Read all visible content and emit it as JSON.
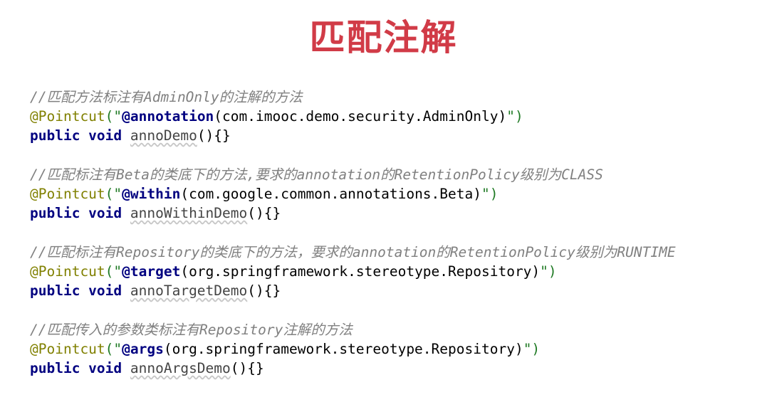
{
  "title": "匹配注解",
  "blocks": [
    {
      "comment": "//匹配方法标注有AdminOnly的注解的方法",
      "pointcut": "@Pointcut",
      "open": "(\"",
      "designator": "@annotation",
      "arg": "(com.imooc.demo.security.AdminOnly)",
      "close": "\")",
      "keywords": "public void",
      "method": "annoDemo",
      "suffix": "(){}"
    },
    {
      "comment": "//匹配标注有Beta的类底下的方法,要求的annotation的RetentionPolicy级别为CLASS",
      "pointcut": "@Pointcut",
      "open": "(\"",
      "designator": "@within",
      "arg": "(com.google.common.annotations.Beta)",
      "close": "\")",
      "keywords": "public void",
      "method": "annoWithinDemo",
      "suffix": "(){}"
    },
    {
      "comment": "//匹配标注有Repository的类底下的方法，要求的annotation的RetentionPolicy级别为RUNTIME",
      "pointcut": "@Pointcut",
      "open": "(\"",
      "designator": "@target",
      "arg": "(org.springframework.stereotype.Repository)",
      "close": "\")",
      "keywords": "public void",
      "method": "annoTargetDemo",
      "suffix": "(){}"
    },
    {
      "comment": "//匹配传入的参数类标注有Repository注解的方法",
      "pointcut": "@Pointcut",
      "open": "(\"",
      "designator": "@args",
      "arg": "(org.springframework.stereotype.Repository)",
      "close": "\")",
      "keywords": "public void",
      "method": "annoArgsDemo",
      "suffix": "(){}"
    }
  ],
  "colors": {
    "title": "#d13b47",
    "comment": "#808080",
    "annotation": "#808000",
    "string": "#1f7a24",
    "keyword": "#000080"
  }
}
